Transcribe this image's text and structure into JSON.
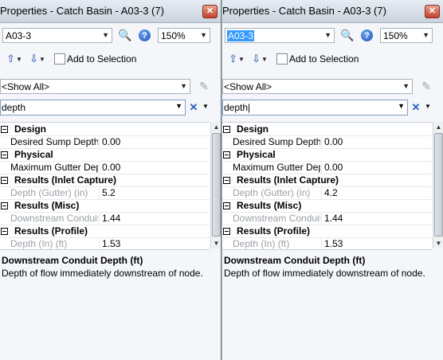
{
  "panels": [
    {
      "title": "Properties - Catch Basin - A03-3 (7)",
      "element_value": "A03-3",
      "element_selected": false,
      "zoom_value": "150%",
      "add_to_selection_label": "Add to Selection",
      "filter_value": "<Show All>",
      "search_value": "depth",
      "rows": [
        {
          "type": "category",
          "label": "Design"
        },
        {
          "type": "property",
          "name": "Desired Sump Depth (",
          "value": "0.00",
          "readonly": false
        },
        {
          "type": "category",
          "label": "Physical"
        },
        {
          "type": "property",
          "name": "Maximum Gutter Dept",
          "value": "0.00",
          "readonly": false
        },
        {
          "type": "category",
          "label": "Results (Inlet Capture)"
        },
        {
          "type": "property",
          "name": "Depth (Gutter) (in)",
          "value": "5.2",
          "readonly": true
        },
        {
          "type": "category",
          "label": "Results (Misc)"
        },
        {
          "type": "property",
          "name": "Downstream Conduit D",
          "value": "1.44",
          "readonly": true
        },
        {
          "type": "category",
          "label": "Results (Profile)"
        },
        {
          "type": "property",
          "name": "Depth (In) (ft)",
          "value": "1.53",
          "readonly": true
        }
      ],
      "description_title": "Downstream Conduit Depth (ft)",
      "description_text": "Depth of flow immediately downstream of node."
    },
    {
      "title": "Properties - Catch Basin - A03-3 (7)",
      "element_value": "A03-3",
      "element_selected": true,
      "zoom_value": "150%",
      "add_to_selection_label": "Add to Selection",
      "filter_value": "<Show All>",
      "search_value": "depth|",
      "rows": [
        {
          "type": "category",
          "label": "Design"
        },
        {
          "type": "property",
          "name": "Desired Sump Depth (",
          "value": "0.00",
          "readonly": false
        },
        {
          "type": "category",
          "label": "Physical"
        },
        {
          "type": "property",
          "name": "Maximum Gutter Dept",
          "value": "0.00",
          "readonly": false
        },
        {
          "type": "category",
          "label": "Results (Inlet Capture)"
        },
        {
          "type": "property",
          "name": "Depth (Gutter) (in)",
          "value": "4.2",
          "readonly": true
        },
        {
          "type": "category",
          "label": "Results (Misc)"
        },
        {
          "type": "property",
          "name": "Downstream Conduit D",
          "value": "1.44",
          "readonly": true
        },
        {
          "type": "category",
          "label": "Results (Profile)"
        },
        {
          "type": "property",
          "name": "Depth (In) (ft)",
          "value": "1.53",
          "readonly": true
        }
      ],
      "description_title": "Downstream Conduit Depth (ft)",
      "description_text": "Depth of flow immediately downstream of node."
    }
  ],
  "icons": {
    "zoom": "zoom-to-icon",
    "help": "help-icon",
    "navigate_up": "navigate-upstream-icon",
    "navigate_down": "navigate-downstream-icon",
    "edit": "pencil-icon",
    "clear": "clear-search-icon",
    "close": "close-icon"
  }
}
